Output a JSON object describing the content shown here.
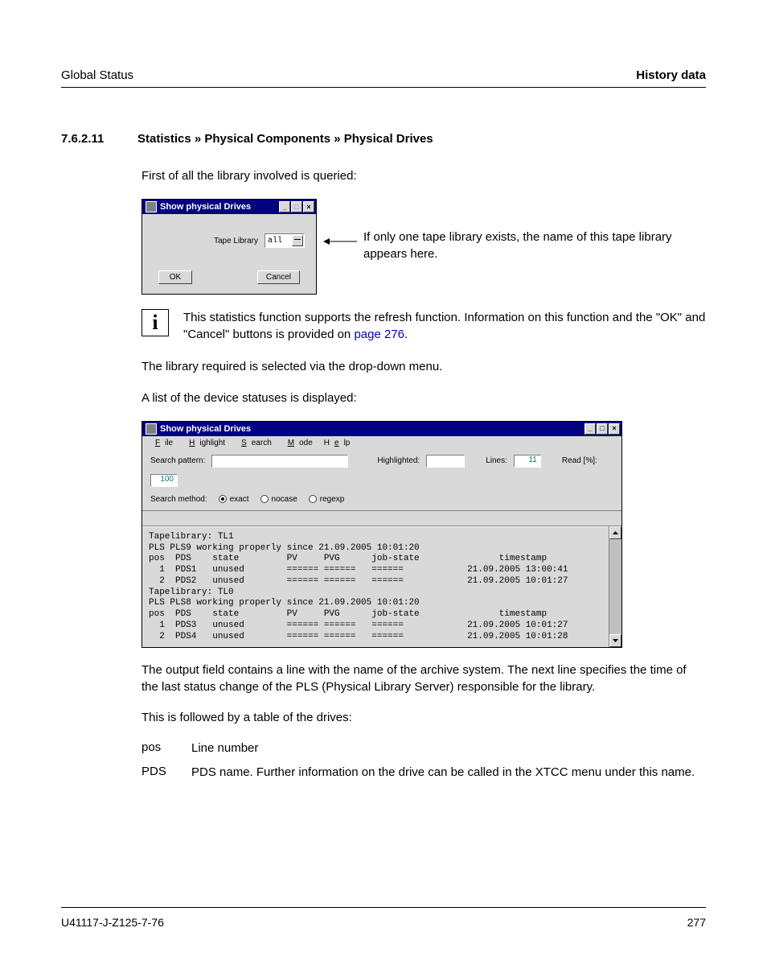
{
  "header": {
    "left": "Global Status",
    "right": "History data"
  },
  "section": {
    "number": "7.6.2.11",
    "title": "Statistics » Physical Components » Physical Drives"
  },
  "intro": "First of all the library involved is queried:",
  "dialog1": {
    "title": "Show physical Drives",
    "field_label": "Tape Library",
    "dropdown_value": "all",
    "ok": "OK",
    "cancel": "Cancel"
  },
  "callout": "If only one tape library exists, the name of this tape library appears here.",
  "info": {
    "prefix": "This statistics function supports the refresh function. Information on this function and the \"OK\" and \"Cancel\" buttons is provided on ",
    "link": "page 276",
    "suffix": "."
  },
  "para2": "The library required is selected via the drop-down menu.",
  "para3": "A list of the device statuses is displayed:",
  "dialog2": {
    "title": "Show physical Drives",
    "menus": [
      "File",
      "Highlight",
      "Search",
      "Mode",
      "Help"
    ],
    "labels": {
      "search_pattern": "Search pattern:",
      "highlighted": "Highlighted:",
      "lines": "Lines:",
      "read": "Read [%]:",
      "search_method": "Search method:",
      "exact": "exact",
      "nocase": "nocase",
      "regexp": "regexp"
    },
    "values": {
      "lines": "11",
      "read": "100"
    },
    "output": "Tapelibrary: TL1\nPLS PLS9 working properly since 21.09.2005 10:01:20\npos  PDS    state         PV     PVG      job-state               timestamp\n  1  PDS1   unused        ====== ======   ======            21.09.2005 13:00:41\n  2  PDS2   unused        ====== ======   ======            21.09.2005 10:01:27\nTapelibrary: TL0\nPLS PLS8 working properly since 21.09.2005 10:01:20\npos  PDS    state         PV     PVG      job-state               timestamp\n  1  PDS3   unused        ====== ======   ======            21.09.2005 10:01:27\n  2  PDS4   unused        ====== ======   ======            21.09.2005 10:01:28"
  },
  "para4": "The output field contains a line with the name of the archive system. The next line specifies the time of the last status change of the PLS (Physical Library Server) responsible for the library.",
  "para5": "This is followed by a table of the drives:",
  "defs": [
    {
      "term": "pos",
      "desc": "Line number"
    },
    {
      "term": "PDS",
      "desc": "PDS name. Further information on the drive can be called in the XTCC menu under this name."
    }
  ],
  "footer": {
    "left": "U41117-J-Z125-7-76",
    "right": "277"
  }
}
